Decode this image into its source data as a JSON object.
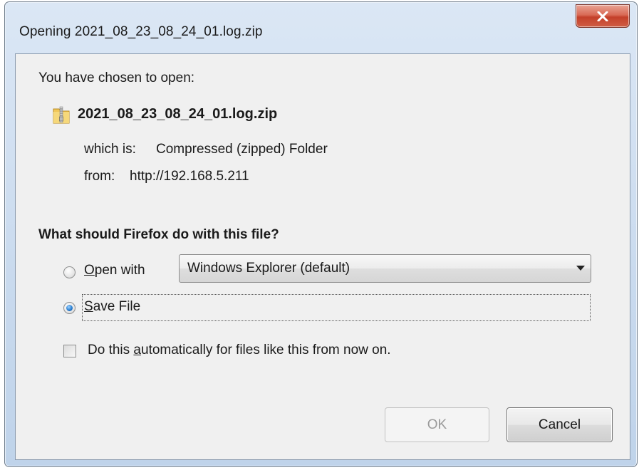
{
  "window": {
    "title": "Opening 2021_08_23_08_24_01.log.zip"
  },
  "intro": {
    "text": "You have chosen to open:",
    "file_name": "2021_08_23_08_24_01.log.zip",
    "file_icon": "zip-folder-icon",
    "which_label": "which is:",
    "which_value": "Compressed (zipped) Folder",
    "from_label": "from:",
    "from_value": "http://192.168.5.211"
  },
  "action": {
    "question": "What should Firefox do with this file?",
    "open_with_label_key": "O",
    "open_with_label_rest": "pen with",
    "open_with_selected": false,
    "open_with_app": "Windows Explorer (default)",
    "save_file_label_key": "S",
    "save_file_label_rest": "ave File",
    "save_file_selected": true,
    "auto_label_pre": "Do this ",
    "auto_label_key": "a",
    "auto_label_post": "utomatically for files like this from now on.",
    "auto_checked": false
  },
  "buttons": {
    "ok_label": "OK",
    "ok_enabled": false,
    "cancel_label": "Cancel"
  },
  "colors": {
    "frame": "#c9daee",
    "close_button": "#c4402a",
    "client_bg": "#f0f0f0",
    "radio_selected": "#2c7fd0"
  }
}
